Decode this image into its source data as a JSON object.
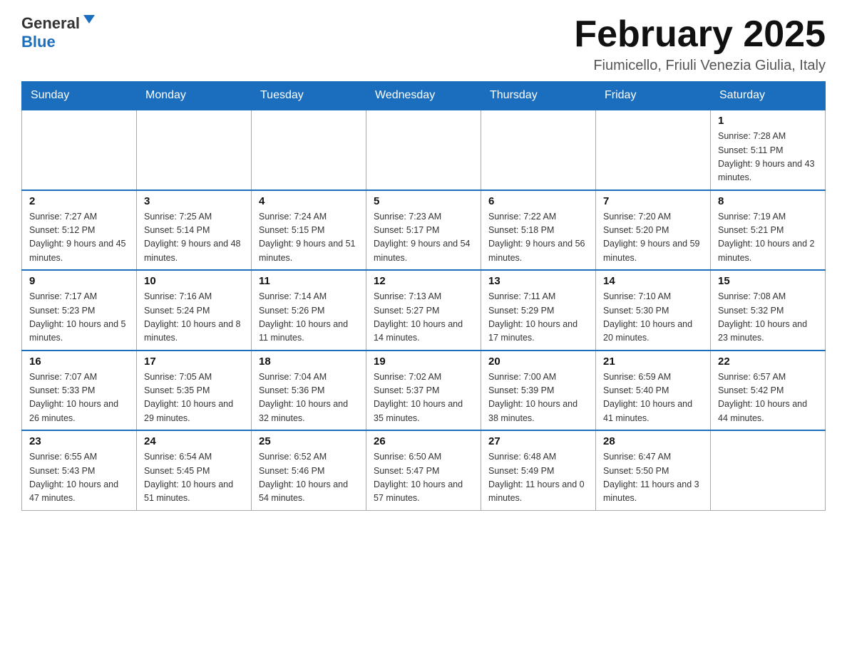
{
  "header": {
    "logo": {
      "general": "General",
      "blue": "Blue"
    },
    "title": "February 2025",
    "location": "Fiumicello, Friuli Venezia Giulia, Italy"
  },
  "weekdays": [
    "Sunday",
    "Monday",
    "Tuesday",
    "Wednesday",
    "Thursday",
    "Friday",
    "Saturday"
  ],
  "weeks": [
    [
      {
        "day": "",
        "info": ""
      },
      {
        "day": "",
        "info": ""
      },
      {
        "day": "",
        "info": ""
      },
      {
        "day": "",
        "info": ""
      },
      {
        "day": "",
        "info": ""
      },
      {
        "day": "",
        "info": ""
      },
      {
        "day": "1",
        "info": "Sunrise: 7:28 AM\nSunset: 5:11 PM\nDaylight: 9 hours and 43 minutes."
      }
    ],
    [
      {
        "day": "2",
        "info": "Sunrise: 7:27 AM\nSunset: 5:12 PM\nDaylight: 9 hours and 45 minutes."
      },
      {
        "day": "3",
        "info": "Sunrise: 7:25 AM\nSunset: 5:14 PM\nDaylight: 9 hours and 48 minutes."
      },
      {
        "day": "4",
        "info": "Sunrise: 7:24 AM\nSunset: 5:15 PM\nDaylight: 9 hours and 51 minutes."
      },
      {
        "day": "5",
        "info": "Sunrise: 7:23 AM\nSunset: 5:17 PM\nDaylight: 9 hours and 54 minutes."
      },
      {
        "day": "6",
        "info": "Sunrise: 7:22 AM\nSunset: 5:18 PM\nDaylight: 9 hours and 56 minutes."
      },
      {
        "day": "7",
        "info": "Sunrise: 7:20 AM\nSunset: 5:20 PM\nDaylight: 9 hours and 59 minutes."
      },
      {
        "day": "8",
        "info": "Sunrise: 7:19 AM\nSunset: 5:21 PM\nDaylight: 10 hours and 2 minutes."
      }
    ],
    [
      {
        "day": "9",
        "info": "Sunrise: 7:17 AM\nSunset: 5:23 PM\nDaylight: 10 hours and 5 minutes."
      },
      {
        "day": "10",
        "info": "Sunrise: 7:16 AM\nSunset: 5:24 PM\nDaylight: 10 hours and 8 minutes."
      },
      {
        "day": "11",
        "info": "Sunrise: 7:14 AM\nSunset: 5:26 PM\nDaylight: 10 hours and 11 minutes."
      },
      {
        "day": "12",
        "info": "Sunrise: 7:13 AM\nSunset: 5:27 PM\nDaylight: 10 hours and 14 minutes."
      },
      {
        "day": "13",
        "info": "Sunrise: 7:11 AM\nSunset: 5:29 PM\nDaylight: 10 hours and 17 minutes."
      },
      {
        "day": "14",
        "info": "Sunrise: 7:10 AM\nSunset: 5:30 PM\nDaylight: 10 hours and 20 minutes."
      },
      {
        "day": "15",
        "info": "Sunrise: 7:08 AM\nSunset: 5:32 PM\nDaylight: 10 hours and 23 minutes."
      }
    ],
    [
      {
        "day": "16",
        "info": "Sunrise: 7:07 AM\nSunset: 5:33 PM\nDaylight: 10 hours and 26 minutes."
      },
      {
        "day": "17",
        "info": "Sunrise: 7:05 AM\nSunset: 5:35 PM\nDaylight: 10 hours and 29 minutes."
      },
      {
        "day": "18",
        "info": "Sunrise: 7:04 AM\nSunset: 5:36 PM\nDaylight: 10 hours and 32 minutes."
      },
      {
        "day": "19",
        "info": "Sunrise: 7:02 AM\nSunset: 5:37 PM\nDaylight: 10 hours and 35 minutes."
      },
      {
        "day": "20",
        "info": "Sunrise: 7:00 AM\nSunset: 5:39 PM\nDaylight: 10 hours and 38 minutes."
      },
      {
        "day": "21",
        "info": "Sunrise: 6:59 AM\nSunset: 5:40 PM\nDaylight: 10 hours and 41 minutes."
      },
      {
        "day": "22",
        "info": "Sunrise: 6:57 AM\nSunset: 5:42 PM\nDaylight: 10 hours and 44 minutes."
      }
    ],
    [
      {
        "day": "23",
        "info": "Sunrise: 6:55 AM\nSunset: 5:43 PM\nDaylight: 10 hours and 47 minutes."
      },
      {
        "day": "24",
        "info": "Sunrise: 6:54 AM\nSunset: 5:45 PM\nDaylight: 10 hours and 51 minutes."
      },
      {
        "day": "25",
        "info": "Sunrise: 6:52 AM\nSunset: 5:46 PM\nDaylight: 10 hours and 54 minutes."
      },
      {
        "day": "26",
        "info": "Sunrise: 6:50 AM\nSunset: 5:47 PM\nDaylight: 10 hours and 57 minutes."
      },
      {
        "day": "27",
        "info": "Sunrise: 6:48 AM\nSunset: 5:49 PM\nDaylight: 11 hours and 0 minutes."
      },
      {
        "day": "28",
        "info": "Sunrise: 6:47 AM\nSunset: 5:50 PM\nDaylight: 11 hours and 3 minutes."
      },
      {
        "day": "",
        "info": ""
      }
    ]
  ]
}
